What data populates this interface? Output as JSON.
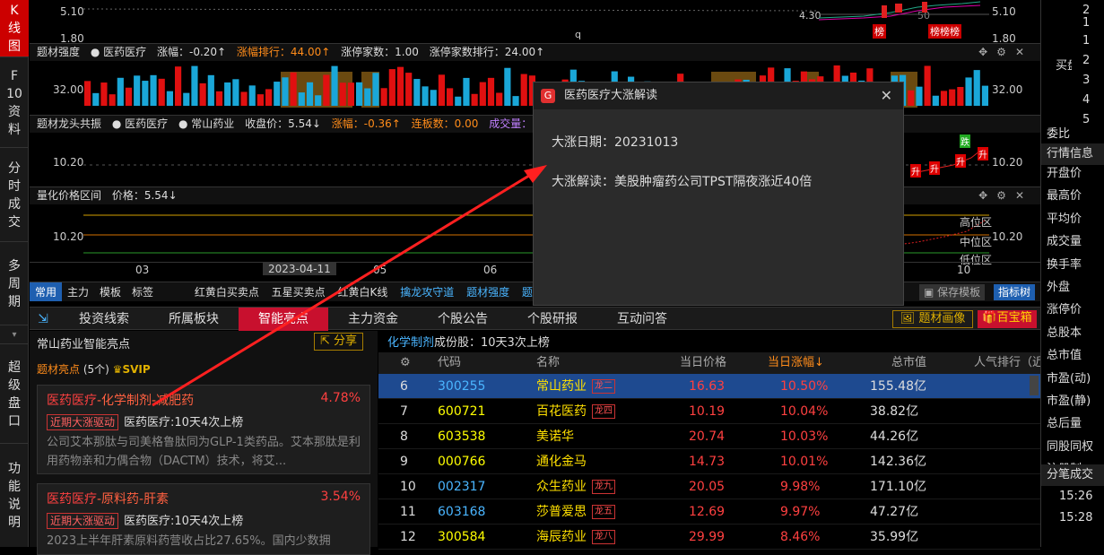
{
  "left_nav": [
    {
      "label": "K线图",
      "chars": [
        "K",
        "线",
        "图"
      ],
      "active": true
    },
    {
      "label": "F10资料",
      "chars": [
        "F",
        "10",
        "资",
        "料"
      ],
      "active": false
    },
    {
      "label": "分时成交",
      "chars": [
        "分",
        "时",
        "成",
        "交"
      ],
      "active": false
    },
    {
      "label": "多周期",
      "chars": [
        "多",
        "周",
        "期"
      ],
      "active": false
    },
    {
      "label": "超级盘口",
      "chars": [
        "超",
        "级",
        "盘",
        "口"
      ],
      "active": false
    },
    {
      "label": "功能说明",
      "chars": [
        "功",
        "能",
        "说",
        "明"
      ],
      "active": false
    }
  ],
  "kline": {
    "price_left_top": "5.10",
    "price_left_bottom": "1.80",
    "price_right_top": "5.10",
    "price_right_bottom": "1.80",
    "low_mark": "4.30",
    "high_mark": "50",
    "tag1": "榜",
    "tag2": "榜榜榜",
    "small_mark": "q"
  },
  "panel1": {
    "title": "题材强度",
    "topic": "医药医疗",
    "change": "涨幅：-0.20↑",
    "rank": "涨幅排行：44.00↑",
    "limitup": "涨停家数：1.00",
    "limitup_rank": "涨停家数排行：24.00↑",
    "ylabel_left": "32.00",
    "ylabel_right": "32.00"
  },
  "panel2": {
    "title": "题材龙头共振",
    "topic": "医药医疗",
    "stock": "常山药业",
    "close": "收盘价：5.54↓",
    "change": "涨幅：-0.36↑",
    "boards": "连板数：0.00",
    "volume": "成交量：3",
    "ylabel_left": "10.20",
    "ylabel_right": "10.20",
    "marks": [
      "跌",
      "升",
      "升",
      "升",
      "升"
    ]
  },
  "panel3": {
    "title": "量化价格区间",
    "price": "价格：5.54↓",
    "ylabel_left": "10.20",
    "ylabel_right": "10.20",
    "zones": [
      "高位区",
      "中位区",
      "低位区"
    ]
  },
  "xaxis": {
    "labels": [
      "03",
      "05",
      "06",
      "10"
    ],
    "date_highlight": "2023-04-11"
  },
  "indicator_bar": {
    "tabs": [
      "常用",
      "主力",
      "模板",
      "标签"
    ],
    "items": [
      "红黄白买卖点",
      "五星买卖点",
      "红黄白K线",
      "擒龙攻守道",
      "题材强度",
      "题材力"
    ],
    "save_template": "保存模板",
    "indicator_lib": "指标树"
  },
  "main_tabs": [
    "投资线索",
    "所属板块",
    "智能亮点",
    "主力资金",
    "个股公告",
    "个股研报",
    "互动问答"
  ],
  "main_tab_active": 2,
  "right_buttons": {
    "topic_image": "题材画像",
    "treasure": "百宝箱"
  },
  "left_pane": {
    "title": "常山药业智能亮点",
    "share": "分享",
    "section": "题材亮点",
    "count": "(5个)",
    "vip": "SVIP",
    "cards": [
      {
        "title_a": "医药医疗",
        "title_b": "-化学制剂-减肥药",
        "pct": "4.78%",
        "tag": "近期大涨驱动",
        "tag_text": "医药医疗:10天4次上榜",
        "desc": "公司艾本那肽与司美格鲁肽同为GLP-1类药品。艾本那肽是利用药物亲和力偶合物（DACTM）技术，将艾..."
      },
      {
        "title_a": "医药医疗",
        "title_b": "-原料药-肝素",
        "pct": "3.54%",
        "tag": "近期大涨驱动",
        "tag_text": "医药医疗:10天4次上榜",
        "desc": "2023上半年肝素原料药营收占比27.65%。国内少数拥"
      }
    ]
  },
  "table": {
    "topic_link": "化学制剂",
    "topic_info": "成份股：10天3次上榜",
    "headers": [
      "代码",
      "名称",
      "当日价格",
      "当日涨幅↓",
      "总市值",
      "人气排行（近"
    ],
    "rows": [
      {
        "n": "6",
        "code": "300255",
        "name": "常山药业",
        "tag": "龙二",
        "price": "16.63",
        "pct": "10.50%",
        "cap": "155.48亿",
        "sel": true
      },
      {
        "n": "7",
        "code": "600721",
        "name": "百花医药",
        "tag": "龙四",
        "price": "10.19",
        "pct": "10.04%",
        "cap": "38.82亿",
        "sel": false
      },
      {
        "n": "8",
        "code": "603538",
        "name": "美诺华",
        "tag": "",
        "price": "20.74",
        "pct": "10.03%",
        "cap": "44.26亿",
        "sel": false
      },
      {
        "n": "9",
        "code": "000766",
        "name": "通化金马",
        "tag": "",
        "price": "14.73",
        "pct": "10.01%",
        "cap": "142.36亿",
        "sel": false
      },
      {
        "n": "10",
        "code": "002317",
        "name": "众生药业",
        "tag": "龙九",
        "price": "20.05",
        "pct": "9.98%",
        "cap": "171.10亿",
        "sel": false
      },
      {
        "n": "11",
        "code": "603168",
        "name": "莎普爱思",
        "tag": "龙五",
        "price": "12.69",
        "pct": "9.97%",
        "cap": "47.27亿",
        "sel": false
      },
      {
        "n": "12",
        "code": "300584",
        "name": "海辰药业",
        "tag": "龙八",
        "price": "29.99",
        "pct": "8.46%",
        "cap": "35.99亿",
        "sel": false
      }
    ]
  },
  "popup": {
    "title": "医药医疗大涨解读",
    "date_label": "大涨日期：20231013",
    "reason_label": "大涨解读：美股肿瘤药公司TPST隔夜涨近40倍"
  },
  "right_panel": {
    "nums": [
      "2",
      "1",
      "1",
      "2",
      "3",
      "4",
      "5"
    ],
    "buy_label": "买盘",
    "items": [
      "委比",
      "行情信息",
      "开盘价",
      "最高价",
      "平均价",
      "成交量",
      "换手率",
      "外盘",
      "涨停价",
      "总股本",
      "总市值",
      "市盈(动)",
      "市盈(静)",
      "总后量",
      "同股同权",
      "注册制",
      "分笔成交"
    ],
    "times": [
      "15:26",
      "15:28"
    ]
  }
}
